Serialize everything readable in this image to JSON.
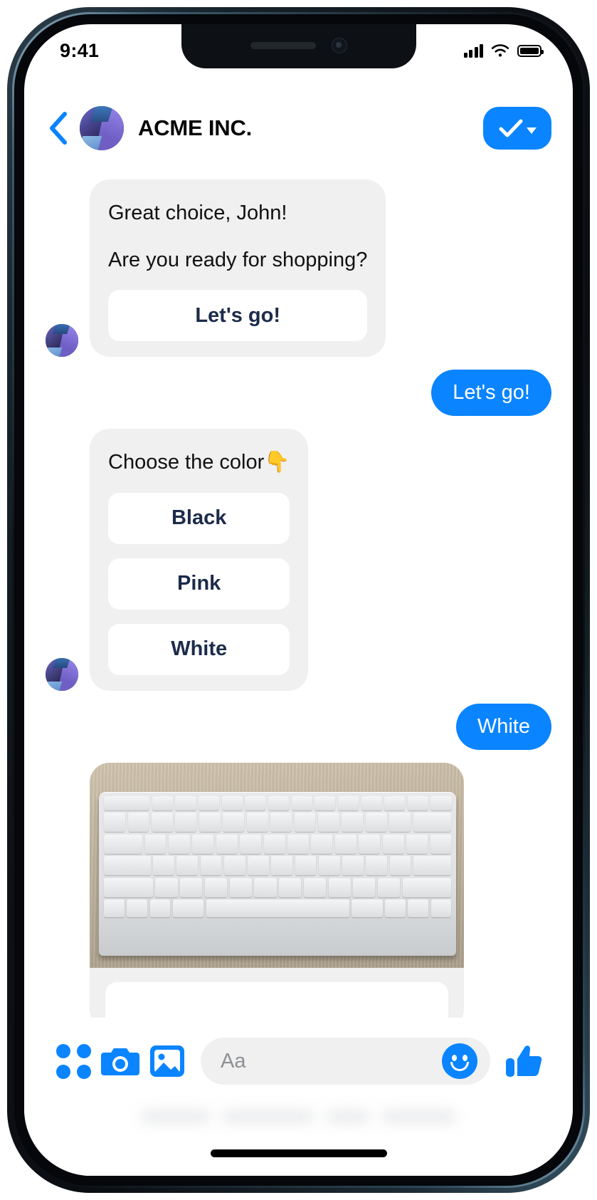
{
  "status_bar": {
    "time": "9:41",
    "signal_icon": "cellular-signal-icon",
    "wifi_icon": "wifi-icon",
    "battery_icon": "battery-full-icon"
  },
  "header": {
    "back_icon": "back-chevron-icon",
    "avatar_icon": "acme-avatar-icon",
    "title": "ACME INC.",
    "action_icon": "checkmark-icon",
    "action_caret_icon": "caret-down-icon",
    "accent_color": "#0a84ff"
  },
  "conversation": {
    "messages": [
      {
        "sender": "bot",
        "lines": [
          "Great choice, John!",
          "Are you ready for shopping?"
        ],
        "buttons": [
          "Let's go!"
        ]
      },
      {
        "sender": "user",
        "text": "Let's go!"
      },
      {
        "sender": "bot",
        "lines": [
          "Choose the color👇"
        ],
        "buttons": [
          "Black",
          "Pink",
          "White"
        ]
      },
      {
        "sender": "user",
        "text": "White"
      },
      {
        "sender": "bot",
        "attachment": "white-keyboard-photo"
      }
    ]
  },
  "toolbar": {
    "grid_icon": "app-grid-icon",
    "camera_icon": "camera-icon",
    "gallery_icon": "image-gallery-icon",
    "composer_placeholder": "Aa",
    "emoji_icon": "smiley-face-icon",
    "like_icon": "thumbs-up-icon"
  },
  "colors": {
    "bubble_in": "#f0f0f0",
    "bubble_out": "#0a84ff",
    "quick_reply_text": "#1c2b4a",
    "accent": "#0a84ff"
  }
}
